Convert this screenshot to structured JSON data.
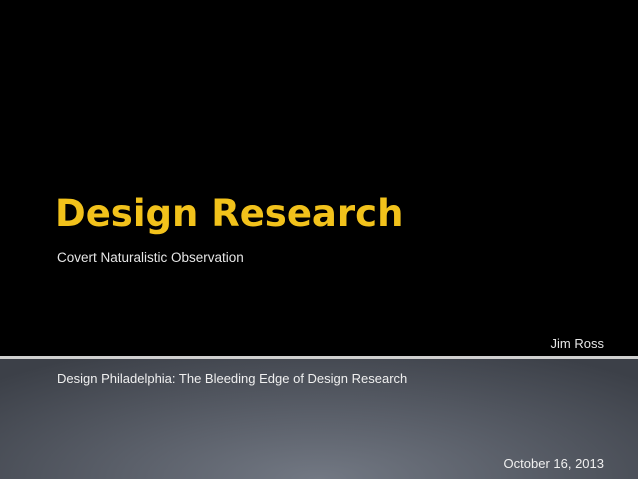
{
  "slide": {
    "title": "Design Research",
    "subtitle": "Covert Naturalistic Observation",
    "author": "Jim Ross",
    "event": "Design Philadelphia: The Bleeding Edge of Design Research",
    "date": "October 16, 2013"
  },
  "colors": {
    "title": "#f2c21b",
    "top_background": "#000000",
    "bottom_background": "#5a5f69",
    "text": "#e6e6e6",
    "divider": "#cfcfcf"
  }
}
